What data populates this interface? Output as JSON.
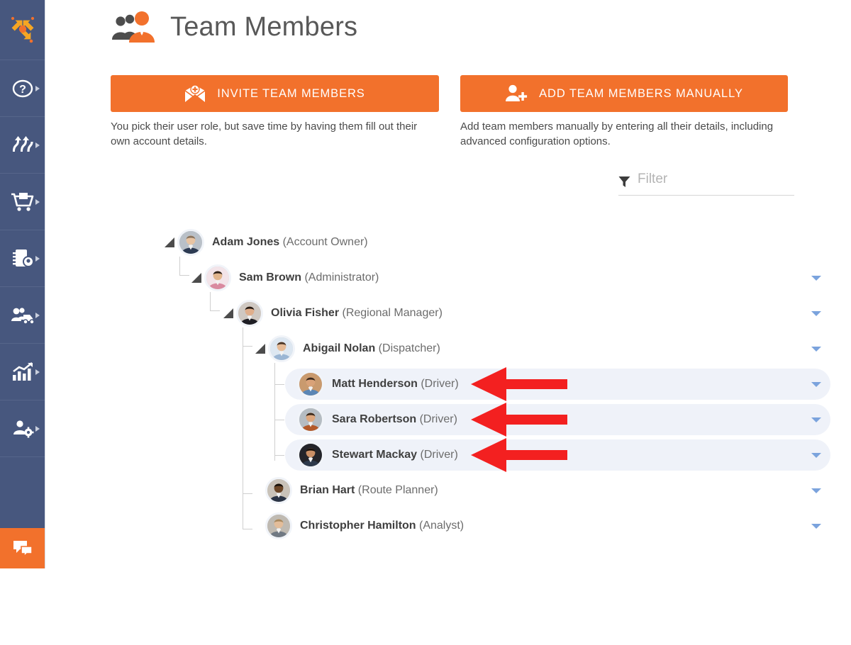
{
  "sidebar": {
    "logo": {
      "name": "route-optimization-logo",
      "alt": "Route planning logo"
    },
    "items": [
      {
        "icon": "question-mark-circle-icon",
        "label": "Help"
      },
      {
        "icon": "routes-icon",
        "label": "Routes"
      },
      {
        "icon": "shopping-cart-icon",
        "label": "Orders"
      },
      {
        "icon": "address-book-icon",
        "label": "Addresses"
      },
      {
        "icon": "team-vehicle-icon",
        "label": "Fleet"
      },
      {
        "icon": "bar-chart-growth-icon",
        "label": "Analytics"
      },
      {
        "icon": "user-settings-icon",
        "label": "Account"
      }
    ],
    "chat": {
      "icon": "chat-bubbles-icon",
      "label": "Chat"
    }
  },
  "header": {
    "title": "Team Members",
    "icon": "team-members-icon"
  },
  "actions": {
    "invite": {
      "label": "INVITE TEAM MEMBERS",
      "icon": "envelope-plus-icon",
      "caption": "You pick their user role, but save time by having them fill out their own account details."
    },
    "add": {
      "label": "ADD TEAM MEMBERS MANUALLY",
      "icon": "person-plus-icon",
      "caption": "Add team members manually by entering all their details, including advanced configuration options."
    }
  },
  "filter": {
    "icon": "funnel-filter-icon",
    "placeholder": "Filter",
    "value": ""
  },
  "tree": {
    "nodes": [
      {
        "name": "Adam Jones",
        "role": "(Account Owner)",
        "depth": 0,
        "collapsible": true,
        "chevron": false,
        "highlighted": false,
        "annotated": false,
        "avatar": "adam-jones-avatar"
      },
      {
        "name": "Sam Brown",
        "role": "(Administrator)",
        "depth": 1,
        "collapsible": true,
        "chevron": true,
        "highlighted": false,
        "annotated": false,
        "avatar": "sam-brown-avatar"
      },
      {
        "name": "Olivia Fisher",
        "role": "(Regional Manager)",
        "depth": 2,
        "collapsible": true,
        "chevron": true,
        "highlighted": false,
        "annotated": false,
        "avatar": "olivia-fisher-avatar"
      },
      {
        "name": "Abigail Nolan",
        "role": "(Dispatcher)",
        "depth": 3,
        "collapsible": true,
        "chevron": true,
        "highlighted": false,
        "annotated": false,
        "avatar": "abigail-nolan-avatar"
      },
      {
        "name": "Matt Henderson",
        "role": "(Driver)",
        "depth": 4,
        "collapsible": false,
        "chevron": true,
        "highlighted": true,
        "annotated": true,
        "avatar": "matt-henderson-avatar"
      },
      {
        "name": "Sara Robertson",
        "role": "(Driver)",
        "depth": 4,
        "collapsible": false,
        "chevron": true,
        "highlighted": true,
        "annotated": true,
        "avatar": "sara-robertson-avatar"
      },
      {
        "name": "Stewart Mackay",
        "role": "(Driver)",
        "depth": 4,
        "collapsible": false,
        "chevron": true,
        "highlighted": true,
        "annotated": true,
        "avatar": "stewart-mackay-avatar"
      },
      {
        "name": "Brian Hart",
        "role": "(Route Planner)",
        "depth": 3,
        "collapsible": false,
        "chevron": true,
        "highlighted": false,
        "annotated": false,
        "avatar": "brian-hart-avatar"
      },
      {
        "name": "Christopher Hamilton",
        "role": "(Analyst)",
        "depth": 3,
        "collapsible": false,
        "chevron": true,
        "highlighted": false,
        "annotated": false,
        "avatar": "christopher-hamilton-avatar"
      }
    ]
  },
  "colors": {
    "sidebar_bg": "#47577e",
    "accent_orange": "#f2712c",
    "row_highlight": "#eff2f9",
    "chevron_blue": "#7ba3dd",
    "annotation_red": "#f32020",
    "title_gray": "#585858"
  }
}
